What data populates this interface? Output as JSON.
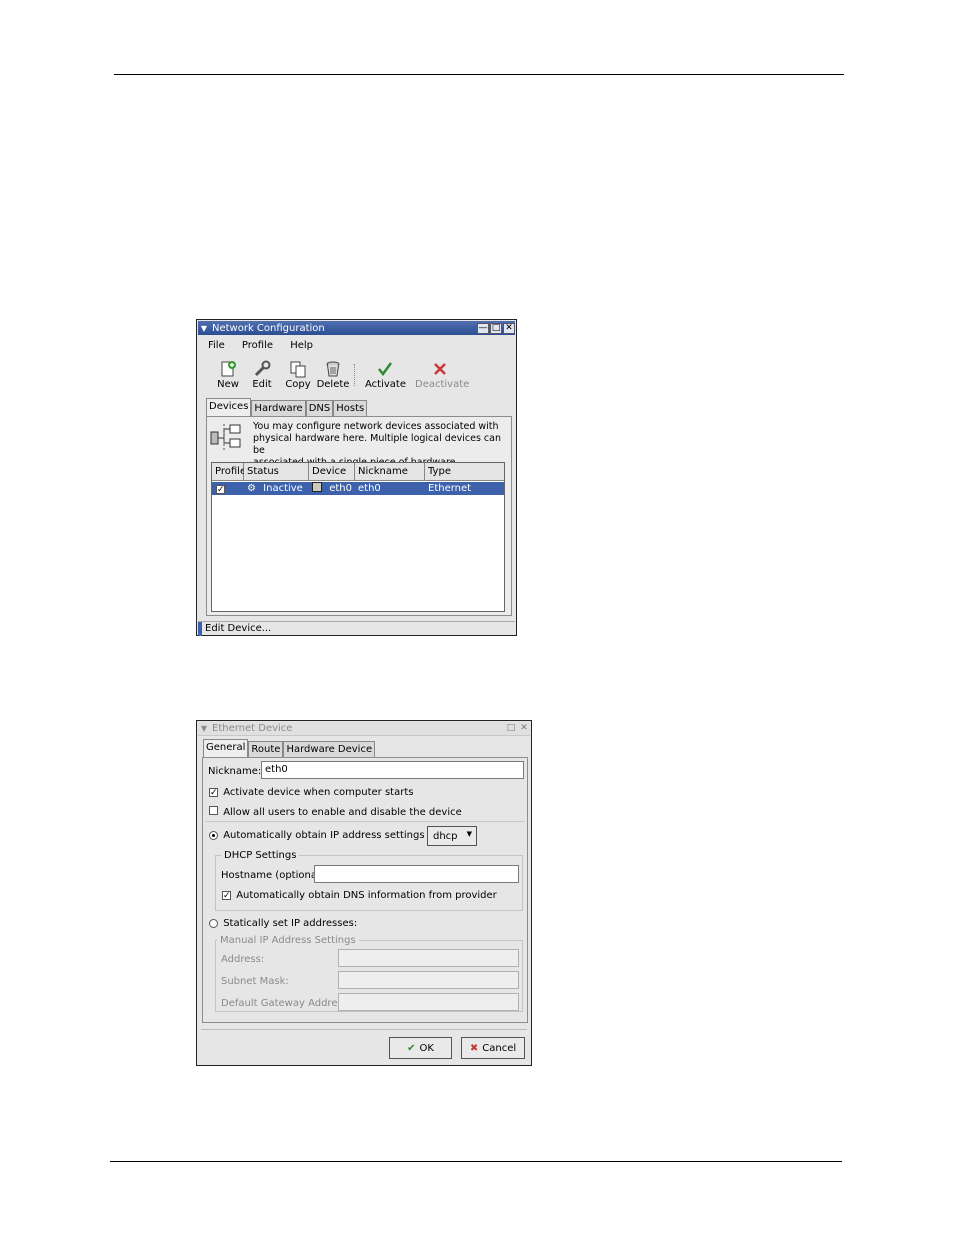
{
  "netconf": {
    "title": "Network Configuration",
    "menu": [
      "File",
      "Profile",
      "Help"
    ],
    "toolbar": {
      "new": "New",
      "edit": "Edit",
      "copy": "Copy",
      "delete": "Delete",
      "activate": "Activate",
      "deactivate": "Deactivate"
    },
    "tabs": [
      "Devices",
      "Hardware",
      "DNS",
      "Hosts"
    ],
    "description": [
      "You may configure network devices associated with",
      "physical hardware here.  Multiple logical devices can be",
      "associated with a single piece of hardware."
    ],
    "columns": [
      "Profile",
      "Status",
      "Device",
      "Nickname",
      "Type"
    ],
    "rows": [
      {
        "profile_checked": true,
        "status": "Inactive",
        "device": "eth0",
        "nickname": "eth0",
        "type": "Ethernet"
      }
    ],
    "statusbar": "Edit Device..."
  },
  "ethdev": {
    "title": "Ethernet Device",
    "tabs": [
      "General",
      "Route",
      "Hardware Device"
    ],
    "nickname_label": "Nickname:",
    "nickname_value": "eth0",
    "activate_on_boot": "Activate device when computer starts",
    "allow_users": "Allow all users to enable and disable the device",
    "auto_obtain": "Automatically obtain IP address settings with:",
    "auto_method": "dhcp",
    "dhcp_settings": "DHCP Settings",
    "hostname_label": "Hostname (optional):",
    "hostname_value": "",
    "auto_dns": "Automatically obtain DNS information from provider",
    "static": "Statically set IP addresses:",
    "manual_settings": "Manual IP Address Settings",
    "address_label": "Address:",
    "subnet_label": "Subnet Mask:",
    "gateway_label": "Default Gateway Address:",
    "ok": "OK",
    "cancel": "Cancel"
  }
}
